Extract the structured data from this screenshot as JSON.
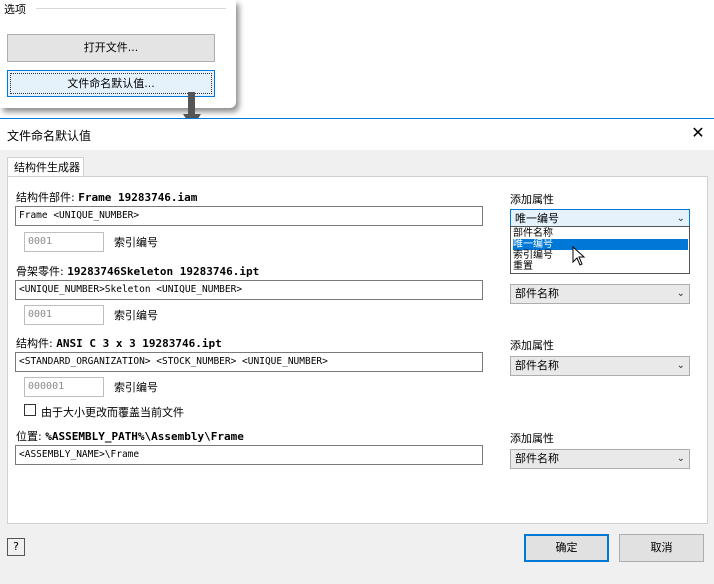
{
  "options": {
    "title": "选项",
    "open_file": "打开文件...",
    "file_naming_defaults": "文件命名默认值..."
  },
  "dialog": {
    "title": "文件命名默认值",
    "tab": "结构件生成器",
    "rows": [
      {
        "label": "结构件部件:",
        "value_bold": "Frame 19283746.iam",
        "field": "Frame <UNIQUE_NUMBER>",
        "index_value": "0001",
        "index_label": "索引编号",
        "add_property": "添加属性",
        "combo": "唯一编号"
      },
      {
        "label": "骨架零件:",
        "value_bold": "19283746Skeleton 19283746.ipt",
        "field": "<UNIQUE_NUMBER>Skeleton <UNIQUE_NUMBER>",
        "index_value": "0001",
        "index_label": "索引编号",
        "combo": "部件名称"
      },
      {
        "label": "结构件:",
        "value_bold": "ANSI C 3 x 3 19283746.ipt",
        "field": "<STANDARD_ORGANIZATION> <STOCK_NUMBER> <UNIQUE_NUMBER>",
        "index_value": "000001",
        "index_label": "索引编号",
        "add_property": "添加属性",
        "combo": "部件名称"
      },
      {
        "label": "位置:",
        "value_bold": "%ASSEMBLY_PATH%\\Assembly\\Frame",
        "field": "<ASSEMBLY_NAME>\\Frame",
        "add_property": "添加属性",
        "combo": "部件名称"
      }
    ],
    "checkbox_label": "由于大小更改而覆盖当前文件",
    "dropdown_options": [
      "部件名称",
      "唯一编号",
      "索引编号",
      "重置"
    ],
    "dropdown_selected": "唯一编号",
    "ok": "确定",
    "cancel": "取消",
    "help_glyph": "?"
  },
  "colors": {
    "accent": "#0078d7",
    "dialog_bg": "#f0f0f0"
  },
  "icons": {
    "close": "close-icon",
    "help": "help-icon",
    "chevron": "chevron-down-icon",
    "arrow": "down-arrow-icon",
    "cursor": "mouse-cursor-icon"
  }
}
